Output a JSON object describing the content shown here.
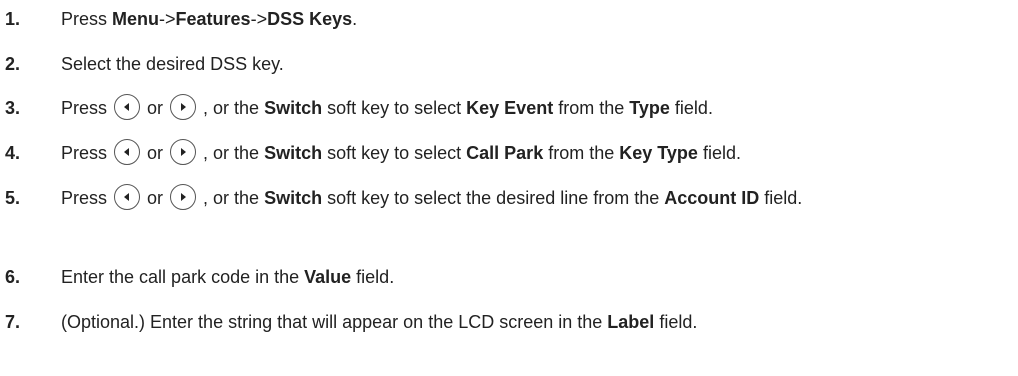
{
  "steps": [
    {
      "num": "1.",
      "parts": [
        {
          "t": "Press "
        },
        {
          "t": "Menu",
          "b": true
        },
        {
          "t": "->"
        },
        {
          "t": "Features",
          "b": true
        },
        {
          "t": "->"
        },
        {
          "t": "DSS Keys",
          "b": true
        },
        {
          "t": "."
        }
      ]
    },
    {
      "num": "2.",
      "parts": [
        {
          "t": "Select the desired DSS key."
        }
      ]
    },
    {
      "num": "3.",
      "parts": [
        {
          "t": "Press "
        },
        {
          "icon": "left-arrow-key-icon"
        },
        {
          "t": " or "
        },
        {
          "icon": "right-arrow-key-icon"
        },
        {
          "t": " , or the "
        },
        {
          "t": "Switch",
          "b": true
        },
        {
          "t": " soft key to select "
        },
        {
          "t": "Key Event",
          "b": true
        },
        {
          "t": " from the "
        },
        {
          "t": "Type",
          "b": true
        },
        {
          "t": " field."
        }
      ]
    },
    {
      "num": "4.",
      "parts": [
        {
          "t": "Press "
        },
        {
          "icon": "left-arrow-key-icon"
        },
        {
          "t": " or "
        },
        {
          "icon": "right-arrow-key-icon"
        },
        {
          "t": " , or the "
        },
        {
          "t": "Switch",
          "b": true
        },
        {
          "t": " soft key to select "
        },
        {
          "t": "Call Park",
          "b": true
        },
        {
          "t": " from the "
        },
        {
          "t": "Key Type",
          "b": true
        },
        {
          "t": " field."
        }
      ]
    },
    {
      "num": "5.",
      "parts": [
        {
          "t": "Press "
        },
        {
          "icon": "left-arrow-key-icon"
        },
        {
          "t": " or "
        },
        {
          "icon": "right-arrow-key-icon"
        },
        {
          "t": " , or the "
        },
        {
          "t": "Switch",
          "b": true
        },
        {
          "t": " soft key to select the desired line from the "
        },
        {
          "t": "Account ID",
          "b": true
        },
        {
          "t": " field."
        }
      ]
    },
    {
      "num": "6.",
      "parts": [
        {
          "t": "Enter the call park code in the "
        },
        {
          "t": "Value",
          "b": true
        },
        {
          "t": " field."
        }
      ]
    },
    {
      "num": "7.",
      "parts": [
        {
          "t": "(Optional.) Enter the string that will appear on the LCD screen in the "
        },
        {
          "t": "Label",
          "b": true
        },
        {
          "t": " field."
        }
      ]
    }
  ]
}
